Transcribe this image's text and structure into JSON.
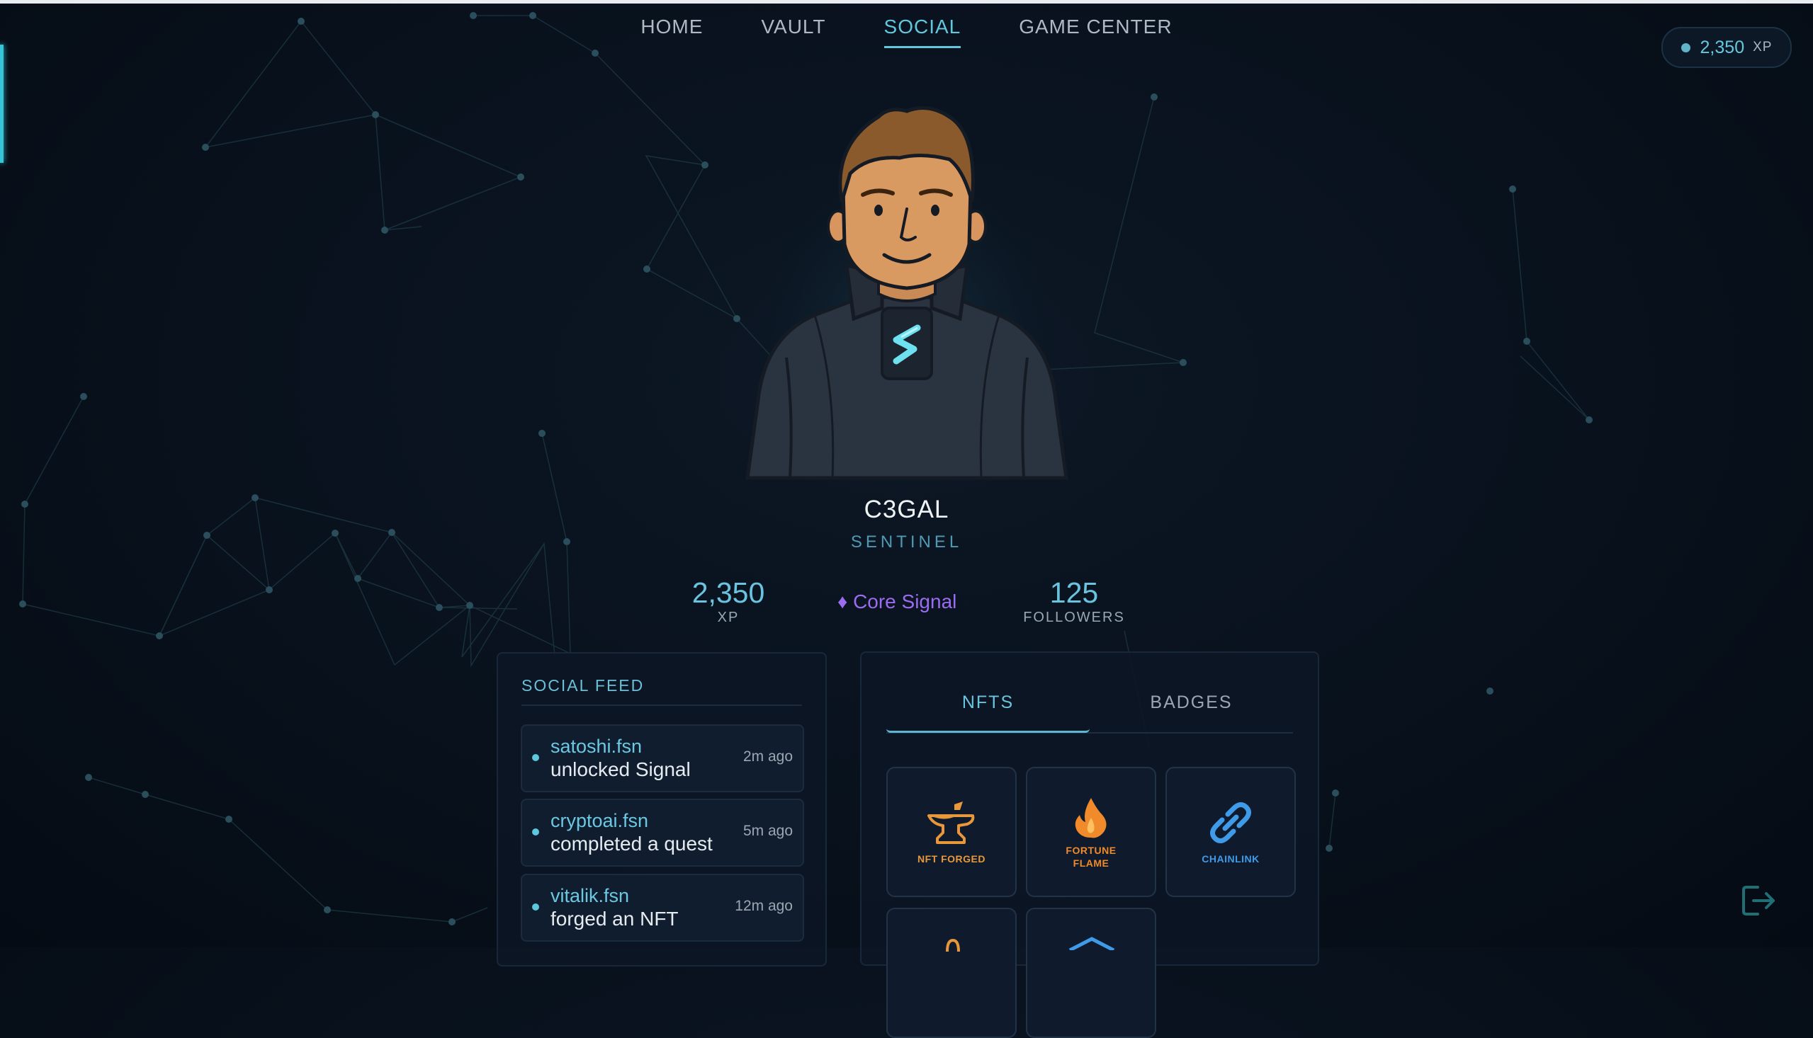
{
  "nav": {
    "items": [
      {
        "label": "HOME",
        "active": false
      },
      {
        "label": "VAULT",
        "active": false
      },
      {
        "label": "SOCIAL",
        "active": true
      },
      {
        "label": "GAME CENTER",
        "active": false
      }
    ]
  },
  "xp_pill": {
    "value": "2,350",
    "unit": "XP"
  },
  "profile": {
    "name": "C3GAL",
    "role": "SENTINEL",
    "stats": {
      "xp": {
        "value": "2,350",
        "label": "XP"
      },
      "signal": {
        "icon": "diamond-icon",
        "text": "♦ Core Signal"
      },
      "followers": {
        "value": "125",
        "label": "FOLLOWERS"
      }
    }
  },
  "feed": {
    "title": "SOCIAL FEED",
    "items": [
      {
        "user": "satoshi.fsn",
        "action": "unlocked Signal",
        "time": "2m ago"
      },
      {
        "user": "cryptoai.fsn",
        "action": "completed a quest",
        "time": "5m ago"
      },
      {
        "user": "vitalik.fsn",
        "action": "forged an NFT",
        "time": "12m ago"
      }
    ]
  },
  "collection": {
    "tabs": [
      {
        "label": "NFTS",
        "active": true
      },
      {
        "label": "BADGES",
        "active": false
      }
    ],
    "cards": [
      {
        "label": "NFT FORGED",
        "icon": "anvil-icon",
        "color": "#e8983a"
      },
      {
        "label_line1": "FORTUNE",
        "label_line2": "FLAME",
        "icon": "flame-icon",
        "color": "#f08a2a"
      },
      {
        "label": "CHAINLINK",
        "icon": "chain-link-icon",
        "color": "#3f9be8"
      }
    ]
  },
  "colors": {
    "accent": "#62c7dc",
    "signal": "#9b6cf0",
    "background": "#08111c"
  }
}
